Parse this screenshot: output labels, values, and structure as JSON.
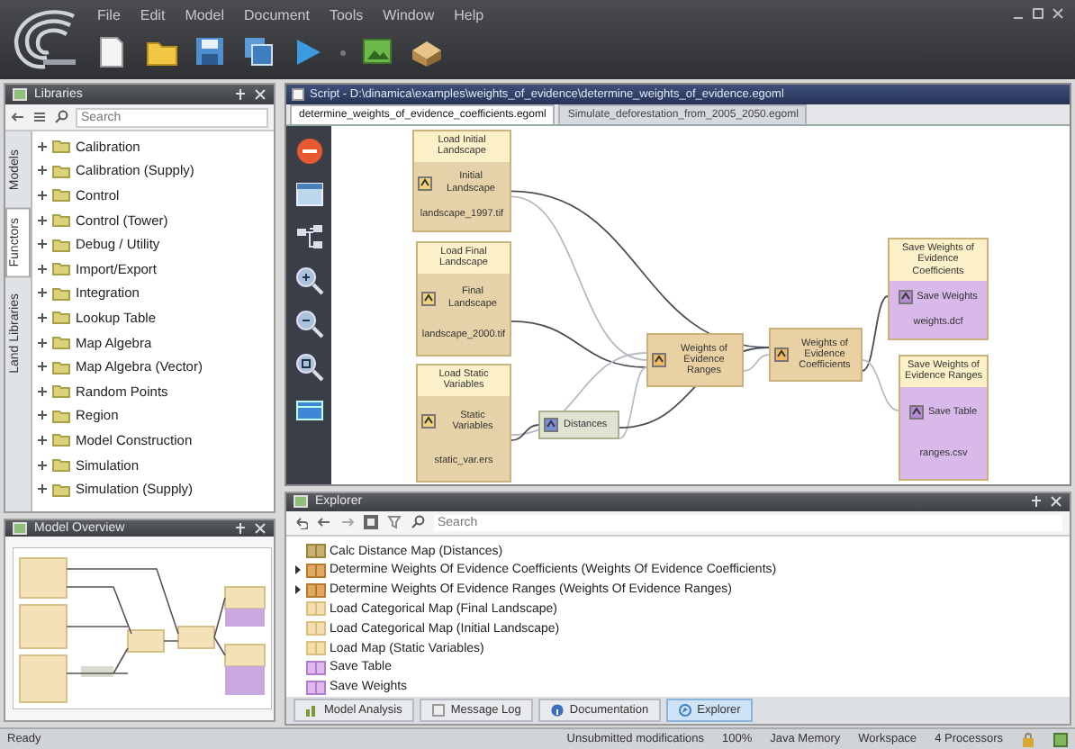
{
  "menu": [
    "File",
    "Edit",
    "Model",
    "Document",
    "Tools",
    "Window",
    "Help"
  ],
  "library": {
    "title": "Libraries",
    "search": {
      "placeholder": "Search"
    },
    "side_tabs": [
      {
        "label": "Models",
        "selected": false
      },
      {
        "label": "Functors",
        "selected": true
      },
      {
        "label": "Land Libraries",
        "selected": false
      }
    ],
    "items": [
      "Calibration",
      "Calibration (Supply)",
      "Control",
      "Control (Tower)",
      "Debug / Utility",
      "Import/Export",
      "Integration",
      "Lookup Table",
      "Map Algebra",
      "Map Algebra (Vector)",
      "Random Points",
      "Region",
      "Model Construction",
      "Simulation",
      "Simulation (Supply)"
    ]
  },
  "overview": {
    "title": "Model Overview"
  },
  "editor": {
    "title": "Script - D:\\dinamica\\examples\\weights_of_evidence\\determine_weights_of_evidence.egoml",
    "tabs": [
      {
        "label": "determine_weights_of_evidence_coefficients.egoml",
        "selected": true
      },
      {
        "label": "Simulate_deforestation_from_2005_2050.egoml",
        "selected": false
      }
    ],
    "nodes": [
      {
        "kind": "load",
        "title": "Load Initial Landscape",
        "functor": "Initial Landscape",
        "file": "landscape_1997.tif"
      },
      {
        "kind": "load",
        "title": "Load Final Landscape",
        "functor": "Final Landscape",
        "file": "landscape_2000.tif"
      },
      {
        "kind": "load",
        "title": "Load Static Variables",
        "functor": "Static Variables",
        "file": "static_var.ers"
      },
      {
        "kind": "calc",
        "title": "Distances"
      },
      {
        "kind": "functor",
        "title": "Weights of Evidence Ranges"
      },
      {
        "kind": "functor",
        "title": "Weights of Evidence Coefficients"
      },
      {
        "kind": "save",
        "title": "Save Weights of Evidence Coefficients",
        "functor": "Save Weights",
        "file": "weights.dcf"
      },
      {
        "kind": "save",
        "title": "Save Weights of Evidence Ranges",
        "functor": "Save Table",
        "file": "ranges.csv"
      }
    ]
  },
  "explorer": {
    "title": "Explorer",
    "search": {
      "placeholder": "Search"
    },
    "items": [
      {
        "kind": "calc",
        "label": "Calc Distance Map (Distances)",
        "expandable": false
      },
      {
        "kind": "weights",
        "label": "Determine Weights Of Evidence Coefficients (Weights Of Evidence Coefficients)",
        "expandable": true
      },
      {
        "kind": "weights",
        "label": "Determine Weights Of Evidence Ranges (Weights Of Evidence Ranges)",
        "expandable": true
      },
      {
        "kind": "load",
        "label": "Load Categorical Map (Final Landscape)",
        "expandable": false
      },
      {
        "kind": "load",
        "label": "Load Categorical Map (Initial Landscape)",
        "expandable": false
      },
      {
        "kind": "load",
        "label": "Load Map (Static Variables)",
        "expandable": false
      },
      {
        "kind": "save",
        "label": "Save Table",
        "expandable": false
      },
      {
        "kind": "save",
        "label": "Save Weights",
        "expandable": false
      }
    ],
    "tabs": [
      {
        "label": "Model Analysis",
        "selected": false
      },
      {
        "label": "Message Log",
        "selected": false
      },
      {
        "label": "Documentation",
        "selected": false
      },
      {
        "label": "Explorer",
        "selected": true
      }
    ]
  },
  "status_bar": [
    "Ready",
    "Unsubmitted modifications",
    "100%",
    "Java Memory",
    "Workspace",
    "4 Processors"
  ]
}
